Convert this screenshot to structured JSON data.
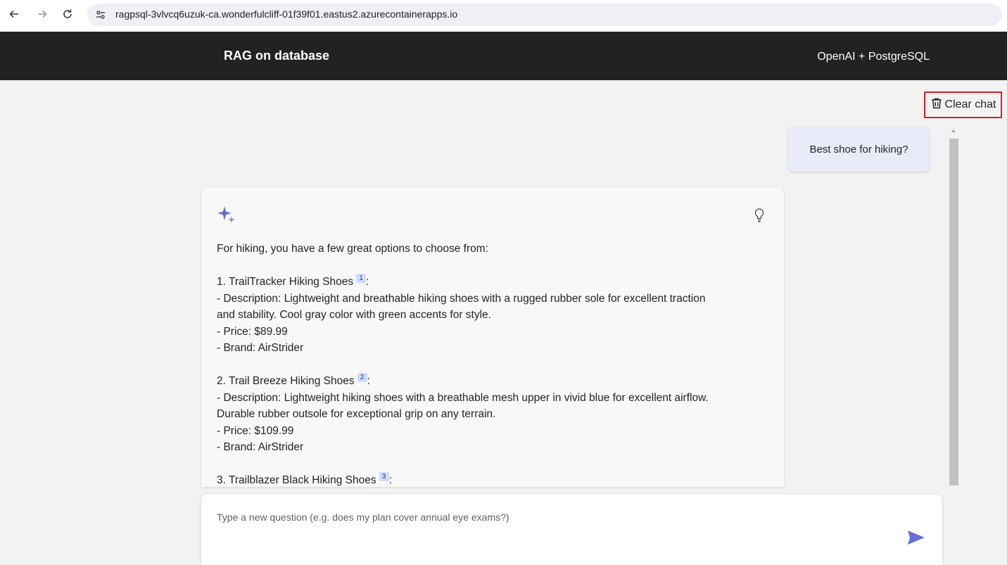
{
  "browser": {
    "url": "ragpsql-3vlvcq6uzuk-ca.wonderfulcliff-01f39f01.eastus2.azurecontainerapps.io"
  },
  "header": {
    "title": "RAG on database",
    "subtitle": "OpenAI + PostgreSQL"
  },
  "toolbar": {
    "clear_chat_label": "Clear chat"
  },
  "chat": {
    "user_question": "Best shoe for hiking?",
    "answer": {
      "intro": "For hiking, you have a few great options to choose from:",
      "items": [
        {
          "title": "1. TrailTracker Hiking Shoes",
          "citation": "1",
          "description_lines": [
            "- Description: Lightweight and breathable hiking shoes with a rugged rubber sole for excellent traction",
            "and stability. Cool gray color with green accents for style."
          ],
          "price": "- Price: $89.99",
          "brand": "- Brand: AirStrider"
        },
        {
          "title": "2. Trail Breeze Hiking Shoes",
          "citation": "2",
          "description_lines": [
            "- Description: Lightweight hiking shoes with a breathable mesh upper in vivid blue for excellent airflow.",
            "Durable rubber outsole for exceptional grip on any terrain."
          ],
          "price": "- Price: $109.99",
          "brand": "- Brand: AirStrider"
        },
        {
          "title": "3. Trailblazer Black Hiking Shoes",
          "citation": "3"
        }
      ]
    }
  },
  "input": {
    "placeholder": "Type a new question (e.g. does my plan cover annual eye exams?)"
  },
  "colors": {
    "header_bg": "#222222",
    "page_bg": "#f2f2f2",
    "accent": "#7f85f5",
    "highlight_border": "#d9202a",
    "user_bubble": "#e9ebf9"
  }
}
